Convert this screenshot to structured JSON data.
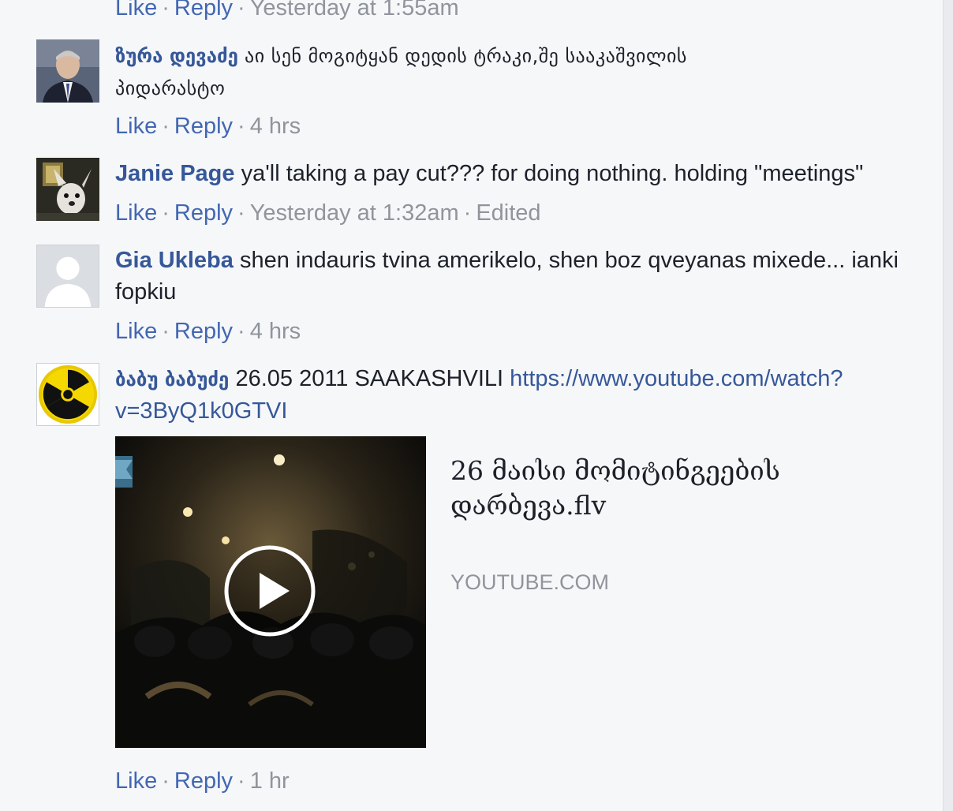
{
  "top_actions": {
    "like": "Like",
    "reply": "Reply",
    "time": "Yesterday at 1:55am"
  },
  "comments": [
    {
      "author": "ზურა დევაძე",
      "text_line1": "აი სენ მოგიტყან დედის ტრაკი,შე სააკაშვილის",
      "text_line2": "პიდარასტო",
      "like": "Like",
      "reply": "Reply",
      "time": "4 hrs"
    },
    {
      "author": "Janie Page",
      "text": "ya'll taking a pay cut??? for doing nothing. holding \"meetings\"",
      "like": "Like",
      "reply": "Reply",
      "time": "Yesterday at 1:32am",
      "edited": "Edited"
    },
    {
      "author": "Gia Ukleba",
      "text_line1": "shen indauris tvina amerikelo, shen boz qveyanas mixede... ianki",
      "text_line2": "fopkiu",
      "like": "Like",
      "reply": "Reply",
      "time": "4 hrs"
    },
    {
      "author": "ბაბუ ბაბუძე",
      "text": "26.05 2011 SAAKASHVILI",
      "link_line1": "https://www.youtube.com/watch?",
      "link_line2": "v=3ByQ1k0GTVI",
      "preview": {
        "title_line1": "26 მაისი მომიტინგეების",
        "title_line2": "დარბევა.flv",
        "domain": "YOUTUBE.COM"
      },
      "like": "Like",
      "reply": "Reply",
      "time": "1 hr"
    }
  ],
  "colors": {
    "background": "#f6f7f9",
    "author_link": "#365899",
    "action_link": "#4267b2",
    "meta_grey": "#90949c",
    "text": "#1d2129"
  },
  "icons": {
    "avatar_default": "default-person-icon",
    "avatar_radiation": "radiation-icon",
    "play": "play-icon"
  }
}
